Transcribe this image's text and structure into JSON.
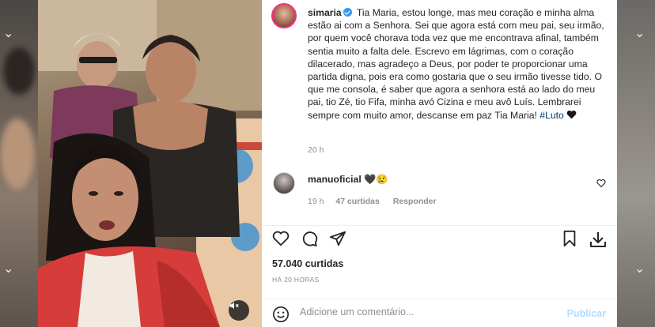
{
  "post": {
    "username": "simaria",
    "verified": true,
    "caption_text": "Tia Maria, estou longe, mas meu coração e minha alma estão ai com a Senhora. Sei que agora está com meu pai, seu irmão, por quem você chorava toda vez que me encontrava afinal, também sentia muito a falta dele. Escrevo em lágrimas, com o coração dilacerado, mas agradeço a Deus, por poder te proporcionar uma partida digna, pois era como gostaria que o seu irmão tivesse tido. O que me consola, é saber que agora a senhora está ao lado do meu pai, tio Zé, tio Fifa, minha avó Cizina e meu avô Luís. Lembrarei sempre com muito amor, descanse em paz Tia Maria!",
    "hashtag": "#Luto",
    "time": "20 h"
  },
  "comment": {
    "username": "manuoficial",
    "emojis": "🖤😢",
    "time": "19 h",
    "likes": "47 curtidas",
    "reply_label": "Responder"
  },
  "stats": {
    "likes": "57.040 curtidas",
    "posted_ago": "HÁ 20 HORAS"
  },
  "composer": {
    "placeholder": "Adicione um comentário...",
    "publish_label": "Publicar"
  },
  "icons": {
    "like": "heart-icon",
    "comment": "comment-icon",
    "share": "share-icon",
    "save": "bookmark-icon",
    "download": "download-icon",
    "mute": "speaker-muted-icon",
    "emoji": "emoji-icon"
  },
  "colors": {
    "verified": "#3897f0",
    "hashtag": "#00376b",
    "publish_disabled": "#b3dbff",
    "muted_text": "#8e8e8e"
  }
}
